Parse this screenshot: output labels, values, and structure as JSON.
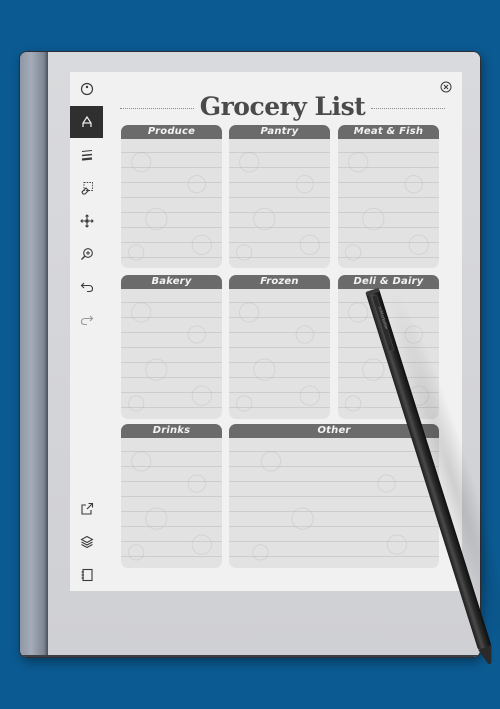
{
  "document": {
    "title": "Grocery List",
    "sections": [
      {
        "label": "Produce"
      },
      {
        "label": "Pantry"
      },
      {
        "label": "Meat & Fish"
      },
      {
        "label": "Bakery"
      },
      {
        "label": "Frozen"
      },
      {
        "label": "Deli & Dairy"
      },
      {
        "label": "Drinks"
      },
      {
        "label": "Other"
      }
    ]
  },
  "toolbar": {
    "top_tools": [
      {
        "name": "menu-circle-icon"
      },
      {
        "name": "pen-tool-icon",
        "active": true
      },
      {
        "name": "stroke-width-icon"
      },
      {
        "name": "eraser-selection-icon"
      },
      {
        "name": "move-icon"
      },
      {
        "name": "zoom-in-icon"
      },
      {
        "name": "undo-icon"
      },
      {
        "name": "redo-icon"
      }
    ],
    "bottom_tools": [
      {
        "name": "share-icon"
      },
      {
        "name": "layers-icon"
      },
      {
        "name": "notebook-icon"
      }
    ]
  },
  "colors": {
    "background": "#0b5a91",
    "section_header": "#6b6b6b",
    "active_tool": "#2f2f2f"
  },
  "pen": {
    "brand": "reMarkable"
  }
}
